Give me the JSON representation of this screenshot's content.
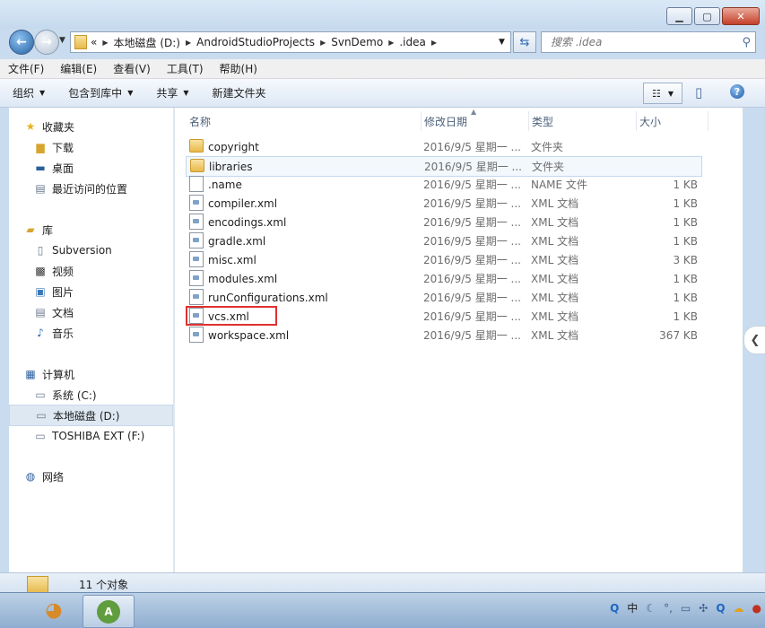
{
  "window": {
    "min_label": "▁",
    "max_label": "▢",
    "close_label": "✕"
  },
  "address": {
    "overflow": "«",
    "segments": [
      "本地磁盘 (D:)",
      "AndroidStudioProjects",
      "SvnDemo",
      ".idea"
    ]
  },
  "search": {
    "placeholder": "搜索 .idea"
  },
  "menu": [
    "文件(F)",
    "编辑(E)",
    "查看(V)",
    "工具(T)",
    "帮助(H)"
  ],
  "toolbar": {
    "organize": "组织",
    "include_library": "包含到库中",
    "share": "共享",
    "new_folder": "新建文件夹"
  },
  "nav": {
    "favorites": "收藏夹",
    "downloads": "下载",
    "desktop": "桌面",
    "recent": "最近访问的位置",
    "libraries": "库",
    "subversion": "Subversion",
    "videos": "视频",
    "pictures": "图片",
    "documents": "文档",
    "music": "音乐",
    "computer": "计算机",
    "drive_c": "系统 (C:)",
    "drive_d": "本地磁盘 (D:)",
    "drive_f": "TOSHIBA EXT (F:)",
    "network": "网络"
  },
  "columns": {
    "name": "名称",
    "date": "修改日期",
    "type": "类型",
    "size": "大小"
  },
  "files": [
    {
      "name": "copyright",
      "date": "2016/9/5 星期一 ...",
      "type": "文件夹",
      "size": "",
      "kind": "folder"
    },
    {
      "name": "libraries",
      "date": "2016/9/5 星期一 ...",
      "type": "文件夹",
      "size": "",
      "kind": "folder"
    },
    {
      "name": ".name",
      "date": "2016/9/5 星期一 ...",
      "type": "NAME 文件",
      "size": "1 KB",
      "kind": "file"
    },
    {
      "name": "compiler.xml",
      "date": "2016/9/5 星期一 ...",
      "type": "XML 文档",
      "size": "1 KB",
      "kind": "xml"
    },
    {
      "name": "encodings.xml",
      "date": "2016/9/5 星期一 ...",
      "type": "XML 文档",
      "size": "1 KB",
      "kind": "xml"
    },
    {
      "name": "gradle.xml",
      "date": "2016/9/5 星期一 ...",
      "type": "XML 文档",
      "size": "1 KB",
      "kind": "xml"
    },
    {
      "name": "misc.xml",
      "date": "2016/9/5 星期一 ...",
      "type": "XML 文档",
      "size": "3 KB",
      "kind": "xml"
    },
    {
      "name": "modules.xml",
      "date": "2016/9/5 星期一 ...",
      "type": "XML 文档",
      "size": "1 KB",
      "kind": "xml"
    },
    {
      "name": "runConfigurations.xml",
      "date": "2016/9/5 星期一 ...",
      "type": "XML 文档",
      "size": "1 KB",
      "kind": "xml"
    },
    {
      "name": "vcs.xml",
      "date": "2016/9/5 星期一 ...",
      "type": "XML 文档",
      "size": "1 KB",
      "kind": "xml"
    },
    {
      "name": "workspace.xml",
      "date": "2016/9/5 星期一 ...",
      "type": "XML 文档",
      "size": "367 KB",
      "kind": "xml"
    }
  ],
  "status": {
    "count": "11 个对象"
  },
  "tray": {
    "ime": "中"
  },
  "colors": {
    "highlight_border": "#e03030",
    "selection": "#dde8f3"
  }
}
